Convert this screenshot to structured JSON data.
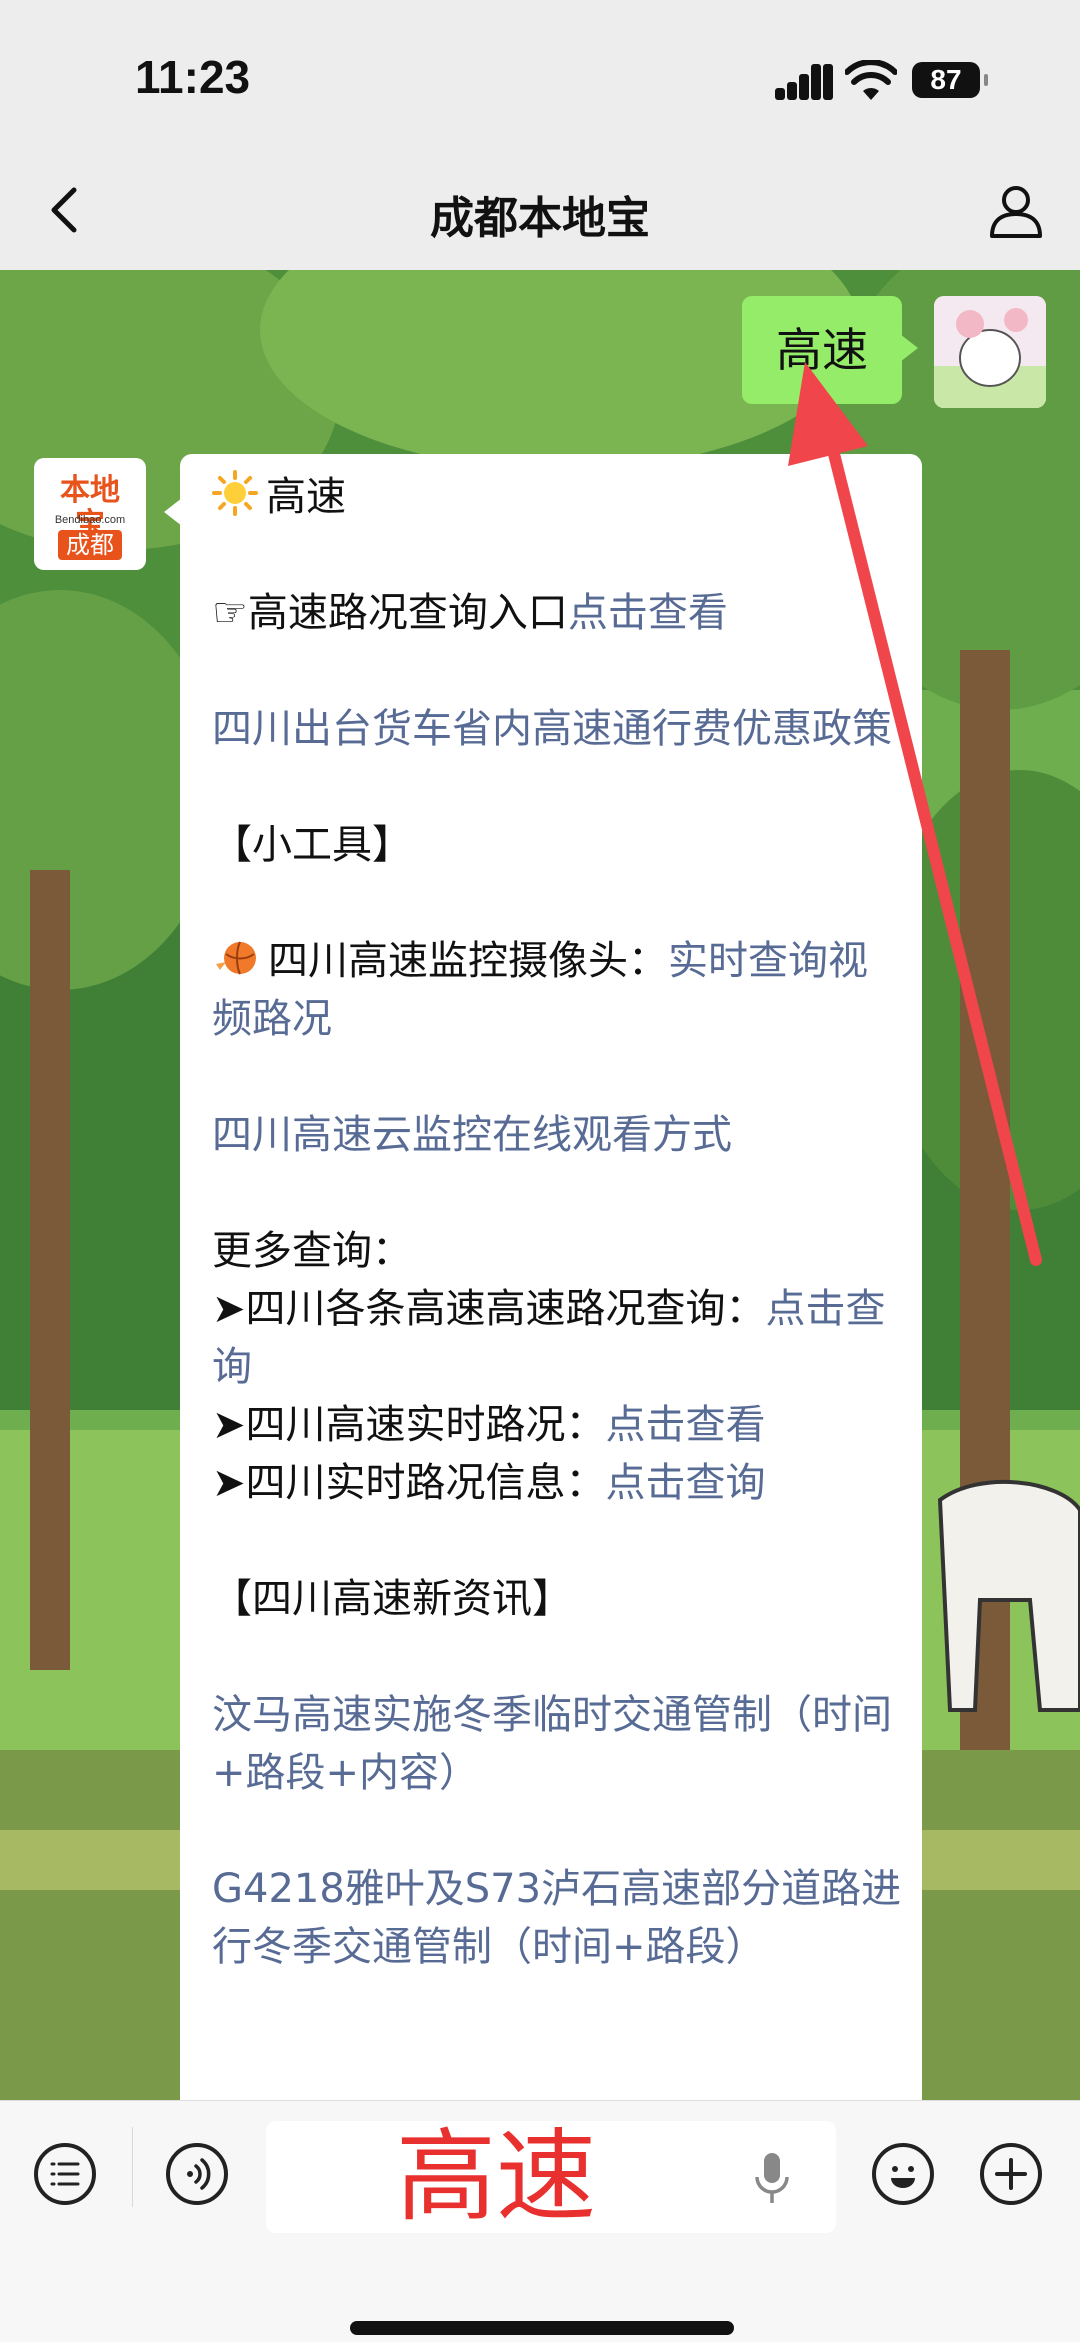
{
  "status": {
    "time": "11:23",
    "battery": "87"
  },
  "nav": {
    "title": "成都本地宝"
  },
  "sent_message": {
    "text": "高速"
  },
  "official_avatar": {
    "top": "本地宝",
    "middle": "Bendibao.com",
    "bottom": "成都"
  },
  "message": {
    "title": "高速",
    "line1_prefix": "☞高速路况查询入口",
    "line1_link": "点击查看",
    "link2": "四川出台货车省内高速通行费优惠政策",
    "tools_header": "【小工具】",
    "camera_prefix": "四川高速监控摄像头：",
    "camera_link": "实时查询视频路况",
    "link3": "四川高速云监控在线观看方式",
    "more_header": "更多查询：",
    "more1_prefix": "➤四川各条高速高速路况查询：",
    "more1_link": "点击查询",
    "more2_prefix": "➤四川高速实时路况：",
    "more2_link": "点击查看",
    "more3_prefix": "➤四川实时路况信息：",
    "more3_link": "点击查询",
    "news_header": "【四川高速新资讯】",
    "news1": "汶马高速实施冬季临时交通管制（时间+路段+内容）",
    "news2": "G4218雅叶及S73泸石高速部分道路进行冬季交通管制（时间+路段）"
  },
  "input": {
    "text": "高速"
  },
  "colors": {
    "link": "#576b95",
    "my_bubble": "#95ec69",
    "arrow": "#f0454a",
    "input_text": "#e8302f"
  }
}
